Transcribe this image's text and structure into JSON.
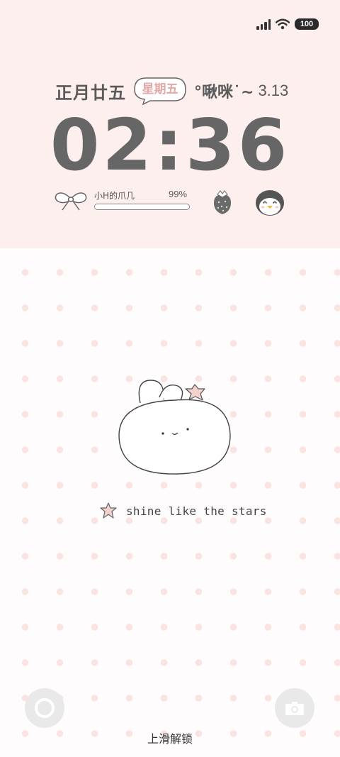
{
  "status_bar": {
    "battery_level": "100",
    "icons": [
      "signal-icon",
      "wifi-icon",
      "battery-icon"
    ]
  },
  "date_row": {
    "lunar_date": "正月廿五",
    "weekday": "星期五",
    "greeting": "°啾咪˙~",
    "date": "3.13"
  },
  "clock": {
    "time": "02:36"
  },
  "battery_widget": {
    "label": "小H的爪几",
    "percent_text": "99%",
    "percent_value": 0.99
  },
  "widget_icons": [
    "bow-icon",
    "strawberry-icon",
    "penguin-icon"
  ],
  "wallpaper": {
    "tagline": "shine like the stars"
  },
  "bottom_bar": {
    "unlock_hint": "上滑解锁",
    "left_shortcut": "circle-icon",
    "right_shortcut": "camera-icon"
  },
  "colors": {
    "top_panel": "#fcefed",
    "dot": "#f9e4e2",
    "text": "#5a5a5a",
    "accent_pink": "#e2a9a9"
  }
}
